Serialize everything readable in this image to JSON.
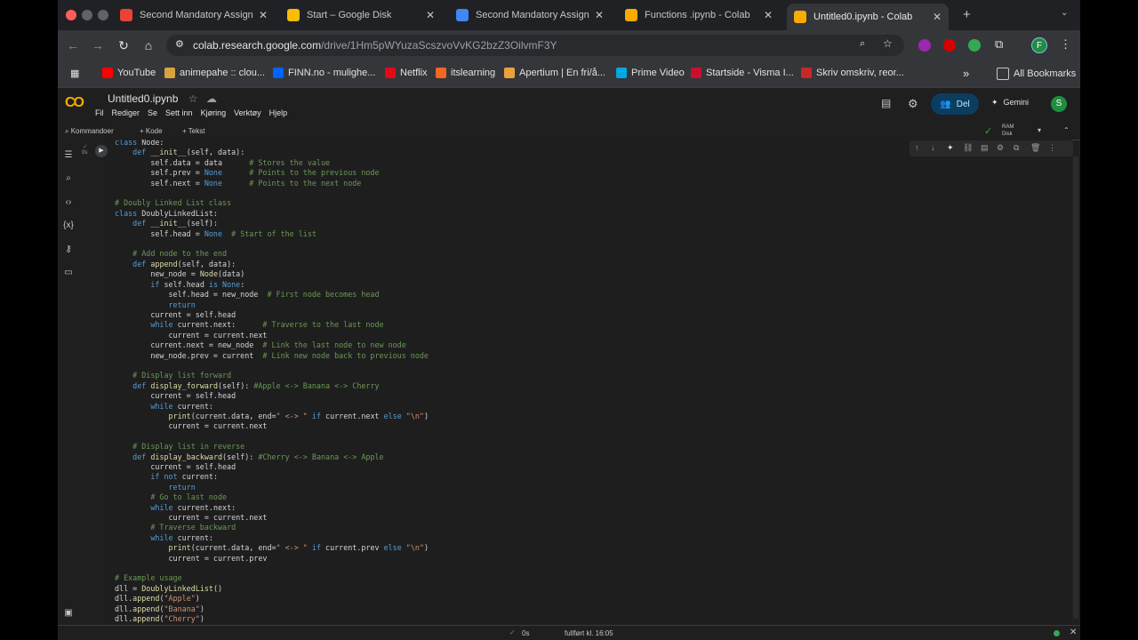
{
  "tabs": [
    {
      "title": "Second Mandatory Assignme",
      "icon": "gear-icon",
      "color": "#ea4335",
      "active": false
    },
    {
      "title": "Start – Google Disk",
      "icon": "drive-icon",
      "color": "#fbbc04",
      "active": false
    },
    {
      "title": "Second Mandatory Assignme",
      "icon": "docs-icon",
      "color": "#4285f4",
      "active": false
    },
    {
      "title": "Functions .ipynb - Colab",
      "icon": "colab-icon",
      "color": "#f9ab00",
      "active": false
    },
    {
      "title": "Untitled0.ipynb - Colab",
      "icon": "colab-icon",
      "color": "#f9ab00",
      "active": true
    }
  ],
  "new_tab": "+",
  "close_glyph": "✕",
  "address": {
    "host": "colab.research.google.com",
    "path": "/drive/1Hm5pWYuzaScszvoVvKG2bzZ3OilvmF3Y"
  },
  "bookmarks": [
    {
      "label": "YouTube",
      "color": "#ff0000"
    },
    {
      "label": "animepahe :: clou...",
      "color": "#d7a33c"
    },
    {
      "label": "FINN.no - mulighe...",
      "color": "#0063fb"
    },
    {
      "label": "Netflix",
      "color": "#e50914"
    },
    {
      "label": "itslearning",
      "color": "#f26722"
    },
    {
      "label": "Apertium | En fri/å...",
      "color": "#e9a23b"
    },
    {
      "label": "Prime Video",
      "color": "#00a8e1"
    },
    {
      "label": "Startside - Visma I...",
      "color": "#c8102e"
    },
    {
      "label": "Skriv omskriv, reor...",
      "color": "#c62828"
    }
  ],
  "bookmarks_more": "»",
  "all_bookmarks": "All Bookmarks",
  "notebook": {
    "logo": "CO",
    "title": "Untitled0.ipynb",
    "menu": [
      "Fil",
      "Rediger",
      "Se",
      "Sett inn",
      "Kjøring",
      "Verktøy",
      "Hjelp"
    ],
    "share": "Del",
    "gemini": "Gemini",
    "avatar": "S",
    "profile": "F"
  },
  "toolbar": {
    "commands": "Kommandoer",
    "code": "+ Kode",
    "text": "+ Tekst",
    "ram": "RAM",
    "disk": "Disk"
  },
  "status": {
    "time": "0s",
    "done": "fullført kl. 16:05"
  },
  "code_lines": [
    "class Node:",
    "    def __init__(self, data):",
    "        self.data = data      # Stores the value",
    "        self.prev = None      # Points to the previous node",
    "        self.next = None      # Points to the next node",
    "",
    "# Doubly Linked List class",
    "class DoublyLinkedList:",
    "    def __init__(self):",
    "        self.head = None  # Start of the list",
    "",
    "    # Add node to the end",
    "    def append(self, data):",
    "        new_node = Node(data)",
    "        if self.head is None:",
    "            self.head = new_node  # First node becomes head",
    "            return",
    "        current = self.head",
    "        while current.next:      # Traverse to the last node",
    "            current = current.next",
    "        current.next = new_node  # Link the last node to new node",
    "        new_node.prev = current  # Link new node back to previous node",
    "",
    "    # Display list forward",
    "    def display_forward(self): #Apple <-> Banana <-> Cherry",
    "        current = self.head",
    "        while current:",
    "            print(current.data, end=\" <-> \" if current.next else \"\\n\")",
    "            current = current.next",
    "",
    "    # Display list in reverse",
    "    def display_backward(self): #Cherry <-> Banana <-> Apple",
    "        current = self.head",
    "        if not current:",
    "            return",
    "        # Go to last node",
    "        while current.next:",
    "            current = current.next",
    "        # Traverse backward",
    "        while current:",
    "            print(current.data, end=\" <-> \" if current.prev else \"\\n\")",
    "            current = current.prev",
    "",
    "# Example usage",
    "dll = DoublyLinkedList()",
    "dll.append(\"Apple\")",
    "dll.append(\"Banana\")",
    "dll.append(\"Cherry\")"
  ]
}
